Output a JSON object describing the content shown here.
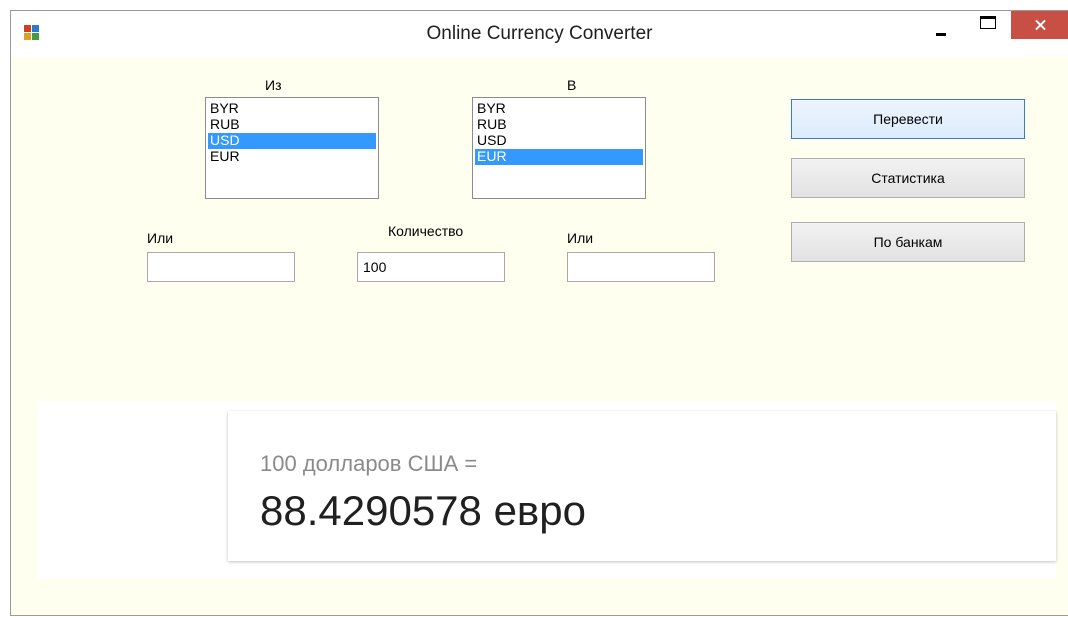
{
  "window": {
    "title": "Online Currency Converter"
  },
  "from": {
    "label": "Из",
    "items": [
      {
        "label": "BYR",
        "selected": false
      },
      {
        "label": "RUB",
        "selected": false
      },
      {
        "label": "USD",
        "selected": true
      },
      {
        "label": "EUR",
        "selected": false
      }
    ],
    "or_label": "Или",
    "or_value": ""
  },
  "to": {
    "label": "В",
    "items": [
      {
        "label": "BYR",
        "selected": false
      },
      {
        "label": "RUB",
        "selected": false
      },
      {
        "label": "USD",
        "selected": false
      },
      {
        "label": "EUR",
        "selected": true
      }
    ],
    "or_label": "Или",
    "or_value": ""
  },
  "amount": {
    "label": "Количество",
    "value": "100"
  },
  "buttons": {
    "convert": "Перевести",
    "statistics": "Статистика",
    "by_banks": "По банкам"
  },
  "result": {
    "source_text": "100 долларов США =",
    "result_text": "88.4290578 евро"
  },
  "colors": {
    "accent": "#3399ff",
    "close": "#c74f43",
    "window_bg": "#fffff0"
  }
}
